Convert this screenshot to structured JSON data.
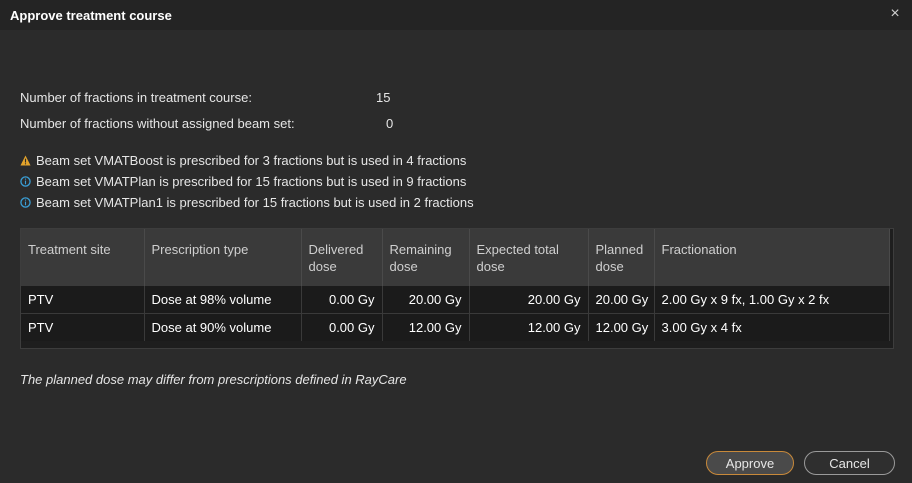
{
  "dialog": {
    "title": "Approve treatment course",
    "close_glyph": "×"
  },
  "summary": [
    {
      "label": "Number of fractions in treatment course:",
      "value": "15"
    },
    {
      "label": "Number of fractions without assigned beam set:",
      "value": "0"
    }
  ],
  "messages": [
    {
      "icon": "warning-icon",
      "color": "#e3a32b",
      "text": "Beam set VMATBoost is prescribed for 3 fractions but is used in 4 fractions"
    },
    {
      "icon": "info-icon",
      "color": "#3aa0d8",
      "text": "Beam set VMATPlan is prescribed for 15 fractions but is used in 9 fractions"
    },
    {
      "icon": "info-icon",
      "color": "#3aa0d8",
      "text": "Beam set VMATPlan1 is prescribed for 15 fractions but is used in 2 fractions"
    }
  ],
  "table": {
    "headers": [
      "Treatment site",
      "Prescription type",
      "Delivered dose",
      "Remaining dose",
      "Expected total dose",
      "Planned dose",
      "Fractionation"
    ],
    "rows": [
      [
        "PTV",
        "Dose at 98% volume",
        "0.00 Gy",
        "20.00 Gy",
        "20.00 Gy",
        "20.00 Gy",
        "2.00 Gy x 9 fx, 1.00 Gy x 2 fx"
      ],
      [
        "PTV",
        "Dose at 90% volume",
        "0.00 Gy",
        "12.00 Gy",
        "12.00 Gy",
        "12.00 Gy",
        "3.00 Gy x 4 fx"
      ]
    ]
  },
  "note": "The planned dose may differ from prescriptions defined in RayCare",
  "buttons": {
    "approve": "Approve",
    "cancel": "Cancel"
  },
  "colors": {
    "approve_border": "#c8893a",
    "warning": "#e3a32b",
    "info": "#3aa0d8"
  }
}
